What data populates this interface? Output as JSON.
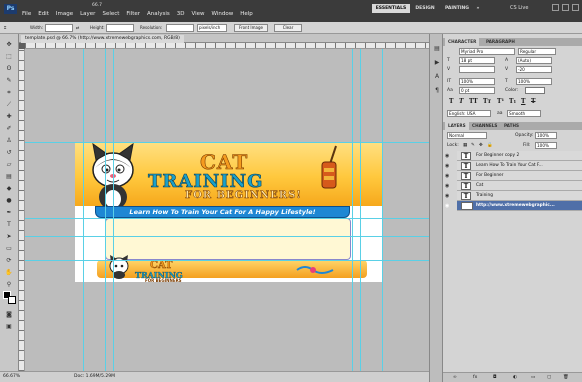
{
  "menu": {
    "app_logo": "Ps",
    "items": [
      "File",
      "Edit",
      "Image",
      "Layer",
      "Select",
      "Filter",
      "Analysis",
      "3D",
      "View",
      "Window",
      "Help"
    ],
    "zoom": "66.7"
  },
  "workspace": {
    "essentials": "ESSENTIALS",
    "design": "DESIGN",
    "painting": "PAINTING",
    "more": "»",
    "cslive": "CS Live"
  },
  "options": {
    "width_label": "Width:",
    "height_label": "Height:",
    "resolution_label": "Resolution:",
    "resolution_unit": "pixels/inch",
    "front_image": "Front Image",
    "clear": "Clear"
  },
  "document": {
    "tab": "template.psd @ 66.7% (http://www.xtremewebgraphics.com, RGB/8)"
  },
  "design": {
    "cat": "CAT",
    "training": "TRAINING",
    "beginners": "FOR BEGINNERS!",
    "tagline": "Learn How To Train Your Cat For A Happy Lifestyle!",
    "footer_cat": "CAT",
    "footer_training": "TRAINING",
    "footer_beginners": "FOR BEGINNERS"
  },
  "status": {
    "zoom": "66.67%",
    "doc": "Doc: 1.69M/5.29M"
  },
  "character": {
    "tab1": "CHARACTER",
    "tab2": "PARAGRAPH",
    "font": "Myriad Pro",
    "style": "Regular",
    "size": "18 pt",
    "leading": "(Auto)",
    "kerning": "",
    "tracking": "-20",
    "vscale": "100%",
    "hscale": "100%",
    "baseline": "0 pt",
    "color_label": "Color:",
    "language": "English: USA",
    "aa_label": "aa",
    "aa": "Smooth"
  },
  "layers": {
    "tab1": "LAYERS",
    "tab2": "CHANNELS",
    "tab3": "PATHS",
    "blend": "Normal",
    "opacity_label": "Opacity:",
    "opacity": "100%",
    "lock_label": "Lock:",
    "fill_label": "Fill:",
    "fill": "100%",
    "items": [
      {
        "name": "For Beginner copy 2",
        "thumb": "T"
      },
      {
        "name": "Learn How To Train Your Cat F...",
        "thumb": "T"
      },
      {
        "name": "For Beginner",
        "thumb": "T"
      },
      {
        "name": "Cat",
        "thumb": "T"
      },
      {
        "name": "Training",
        "thumb": "T"
      },
      {
        "name": "http://www.xtremewebgraphic...",
        "thumb": ""
      }
    ]
  },
  "colors": {
    "accent": "#f49b1f",
    "blue": "#1aa0c8",
    "selected_layer": "#4f6fa8"
  }
}
